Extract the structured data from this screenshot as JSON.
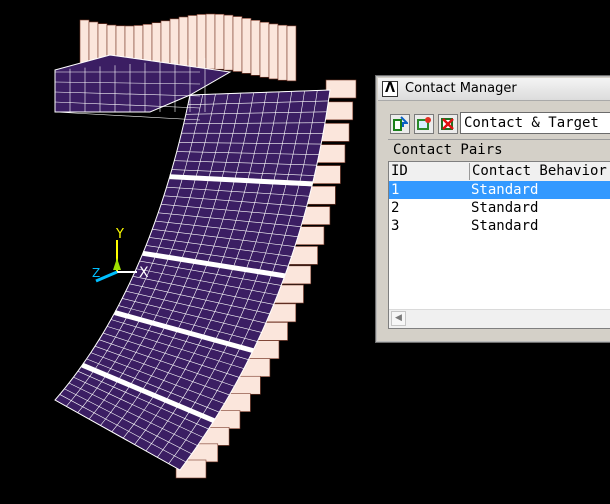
{
  "viewport": {
    "background": "#000000",
    "mesh_fill": "#3b1e63",
    "mesh_line": "#ffffff",
    "target_fill": "#fbe6dc",
    "target_line": "#7a3a2a",
    "triad": {
      "x_label": "X",
      "y_label": "Y",
      "z_label": "Z",
      "x_color": "#ffffff",
      "y_color": "#ffff00",
      "z_color": "#00bfff"
    }
  },
  "contact_manager": {
    "title": "Contact Manager",
    "logo_text": "Λ",
    "toolbar": {
      "buttons": [
        {
          "name": "contact-wizard-button",
          "icon": "contact-wizard-icon"
        },
        {
          "name": "pair-properties-button",
          "icon": "pair-properties-icon"
        },
        {
          "name": "delete-pair-button",
          "icon": "delete-pair-icon"
        }
      ],
      "view_select": "Contact & Target"
    },
    "section_label": "Contact Pairs",
    "columns": [
      "ID",
      "Contact Behavior"
    ],
    "rows": [
      {
        "id": "1",
        "behavior": "Standard",
        "selected": true
      },
      {
        "id": "2",
        "behavior": "Standard",
        "selected": false
      },
      {
        "id": "3",
        "behavior": "Standard",
        "selected": false
      }
    ],
    "selection_color": "#3399ff"
  }
}
